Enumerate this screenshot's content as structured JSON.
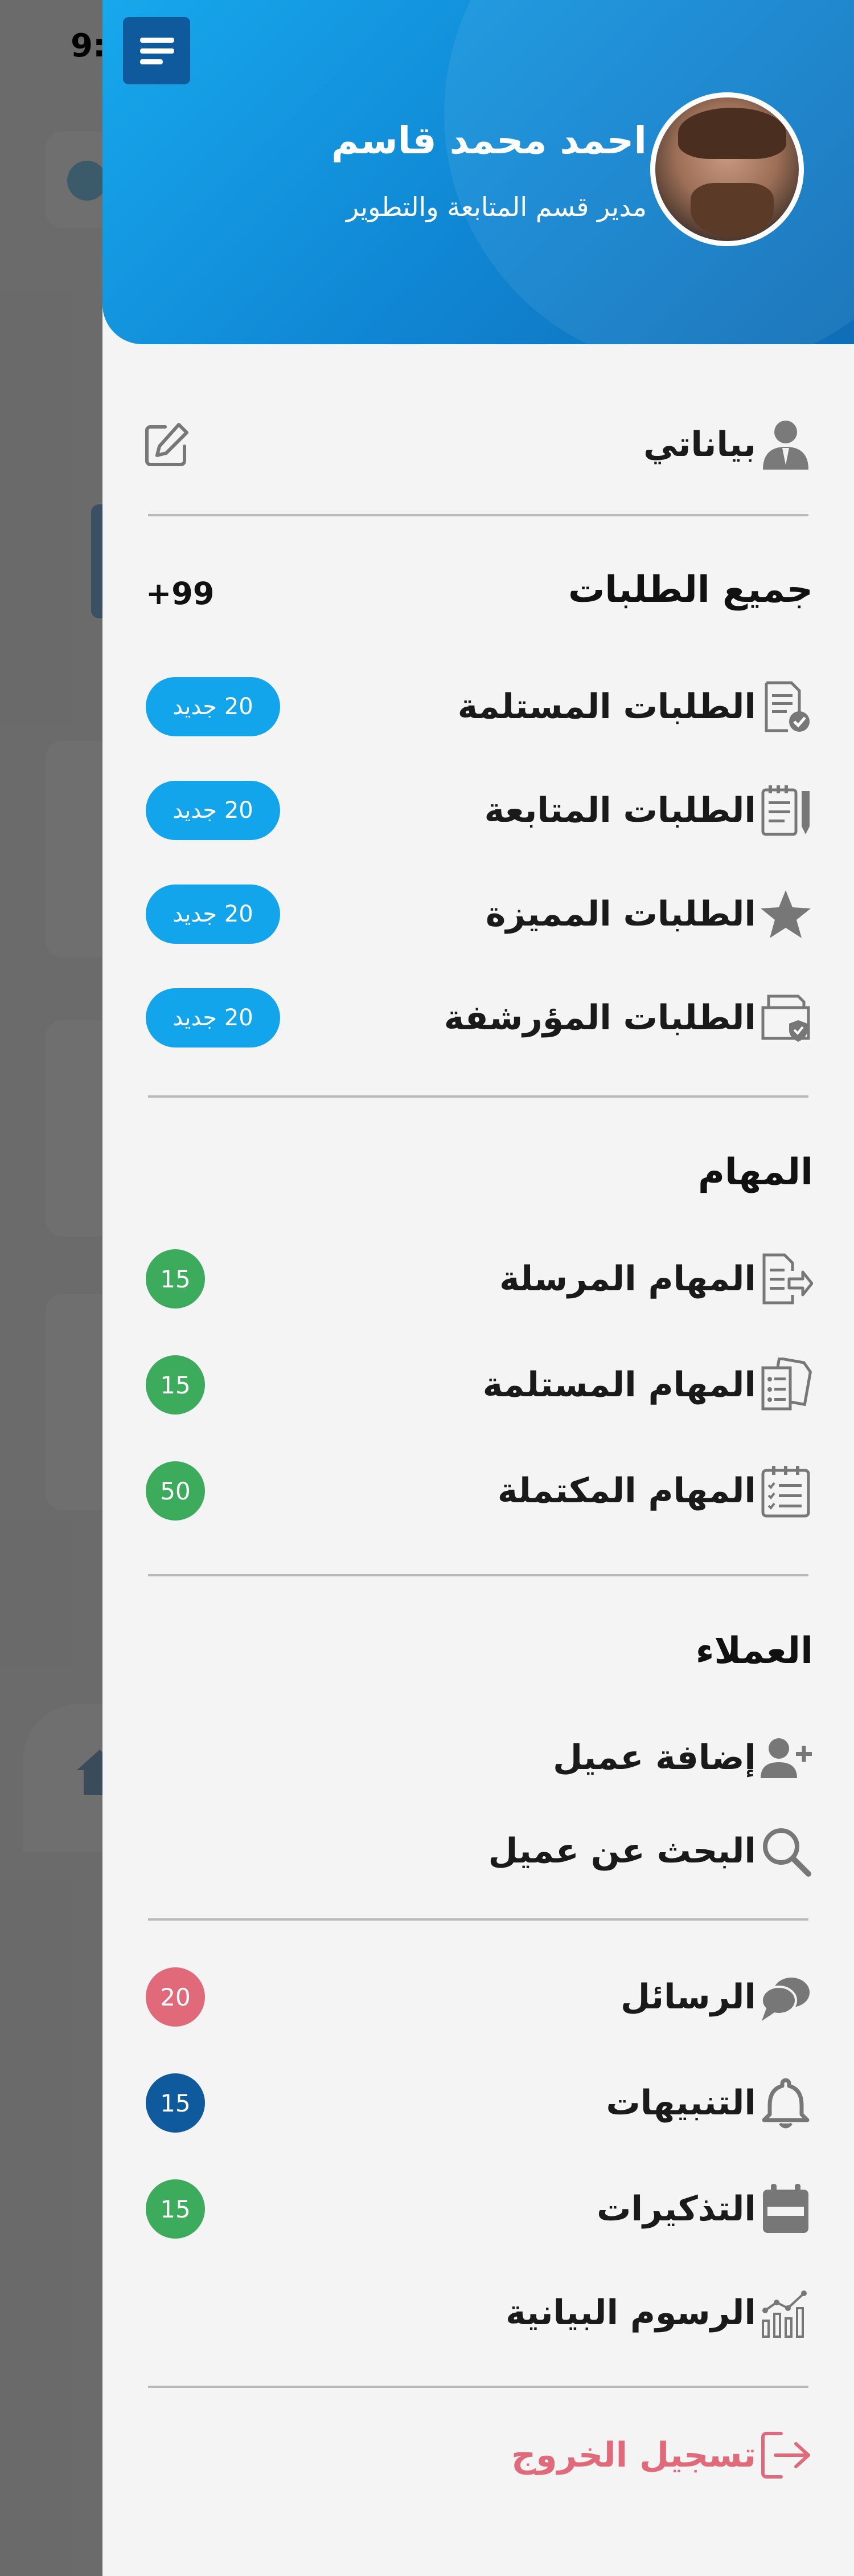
{
  "status": {
    "time": "9:"
  },
  "colors": {
    "accent": "#12a5ec",
    "header_dark": "#0f6db6",
    "green_badge": "#3cab5c",
    "red_badge": "#e06a7a",
    "navy_badge": "#0e5a9c",
    "logout": "#e06a7a"
  },
  "profile": {
    "name": "احمد محمد قاسم",
    "role": "مدير قسم المتابعة والتطوير",
    "my_data_label": "بياناتي",
    "edit_icon": "edit-icon",
    "user_icon": "user-icon"
  },
  "requests": {
    "title": "جميع الطلبات",
    "total": "+99",
    "items": [
      {
        "label": "الطلبات المستلمة",
        "badge": "20 جديد",
        "icon": "received-requests-icon"
      },
      {
        "label": "الطلبات المتابعة",
        "badge": "20 جديد",
        "icon": "followed-requests-icon"
      },
      {
        "label": "الطلبات المميزة",
        "badge": "20 جديد",
        "icon": "star-icon"
      },
      {
        "label": "الطلبات المؤرشفة",
        "badge": "20 جديد",
        "icon": "archive-icon"
      }
    ]
  },
  "tasks": {
    "title": "المهام",
    "items": [
      {
        "label": "المهام المرسلة",
        "badge": "15",
        "icon": "sent-tasks-icon"
      },
      {
        "label": "المهام المستلمة",
        "badge": "15",
        "icon": "received-tasks-icon"
      },
      {
        "label": "المهام المكتملة",
        "badge": "50",
        "icon": "completed-tasks-icon"
      }
    ]
  },
  "clients": {
    "title": "العملاء",
    "items": [
      {
        "label": "إضافة عميل",
        "icon": "add-user-icon"
      },
      {
        "label": "البحث عن عميل",
        "icon": "search-icon"
      }
    ]
  },
  "misc": {
    "items": [
      {
        "label": "الرسائل",
        "badge": "20",
        "icon": "chat-icon"
      },
      {
        "label": "التنبيهات",
        "badge": "15",
        "icon": "bell-icon"
      },
      {
        "label": "التذكيرات",
        "badge": "15",
        "icon": "calendar-icon"
      },
      {
        "label": "الرسوم البيانية",
        "icon": "chart-icon"
      }
    ]
  },
  "logout": {
    "label": "تسجيل الخروج",
    "icon": "logout-icon"
  }
}
